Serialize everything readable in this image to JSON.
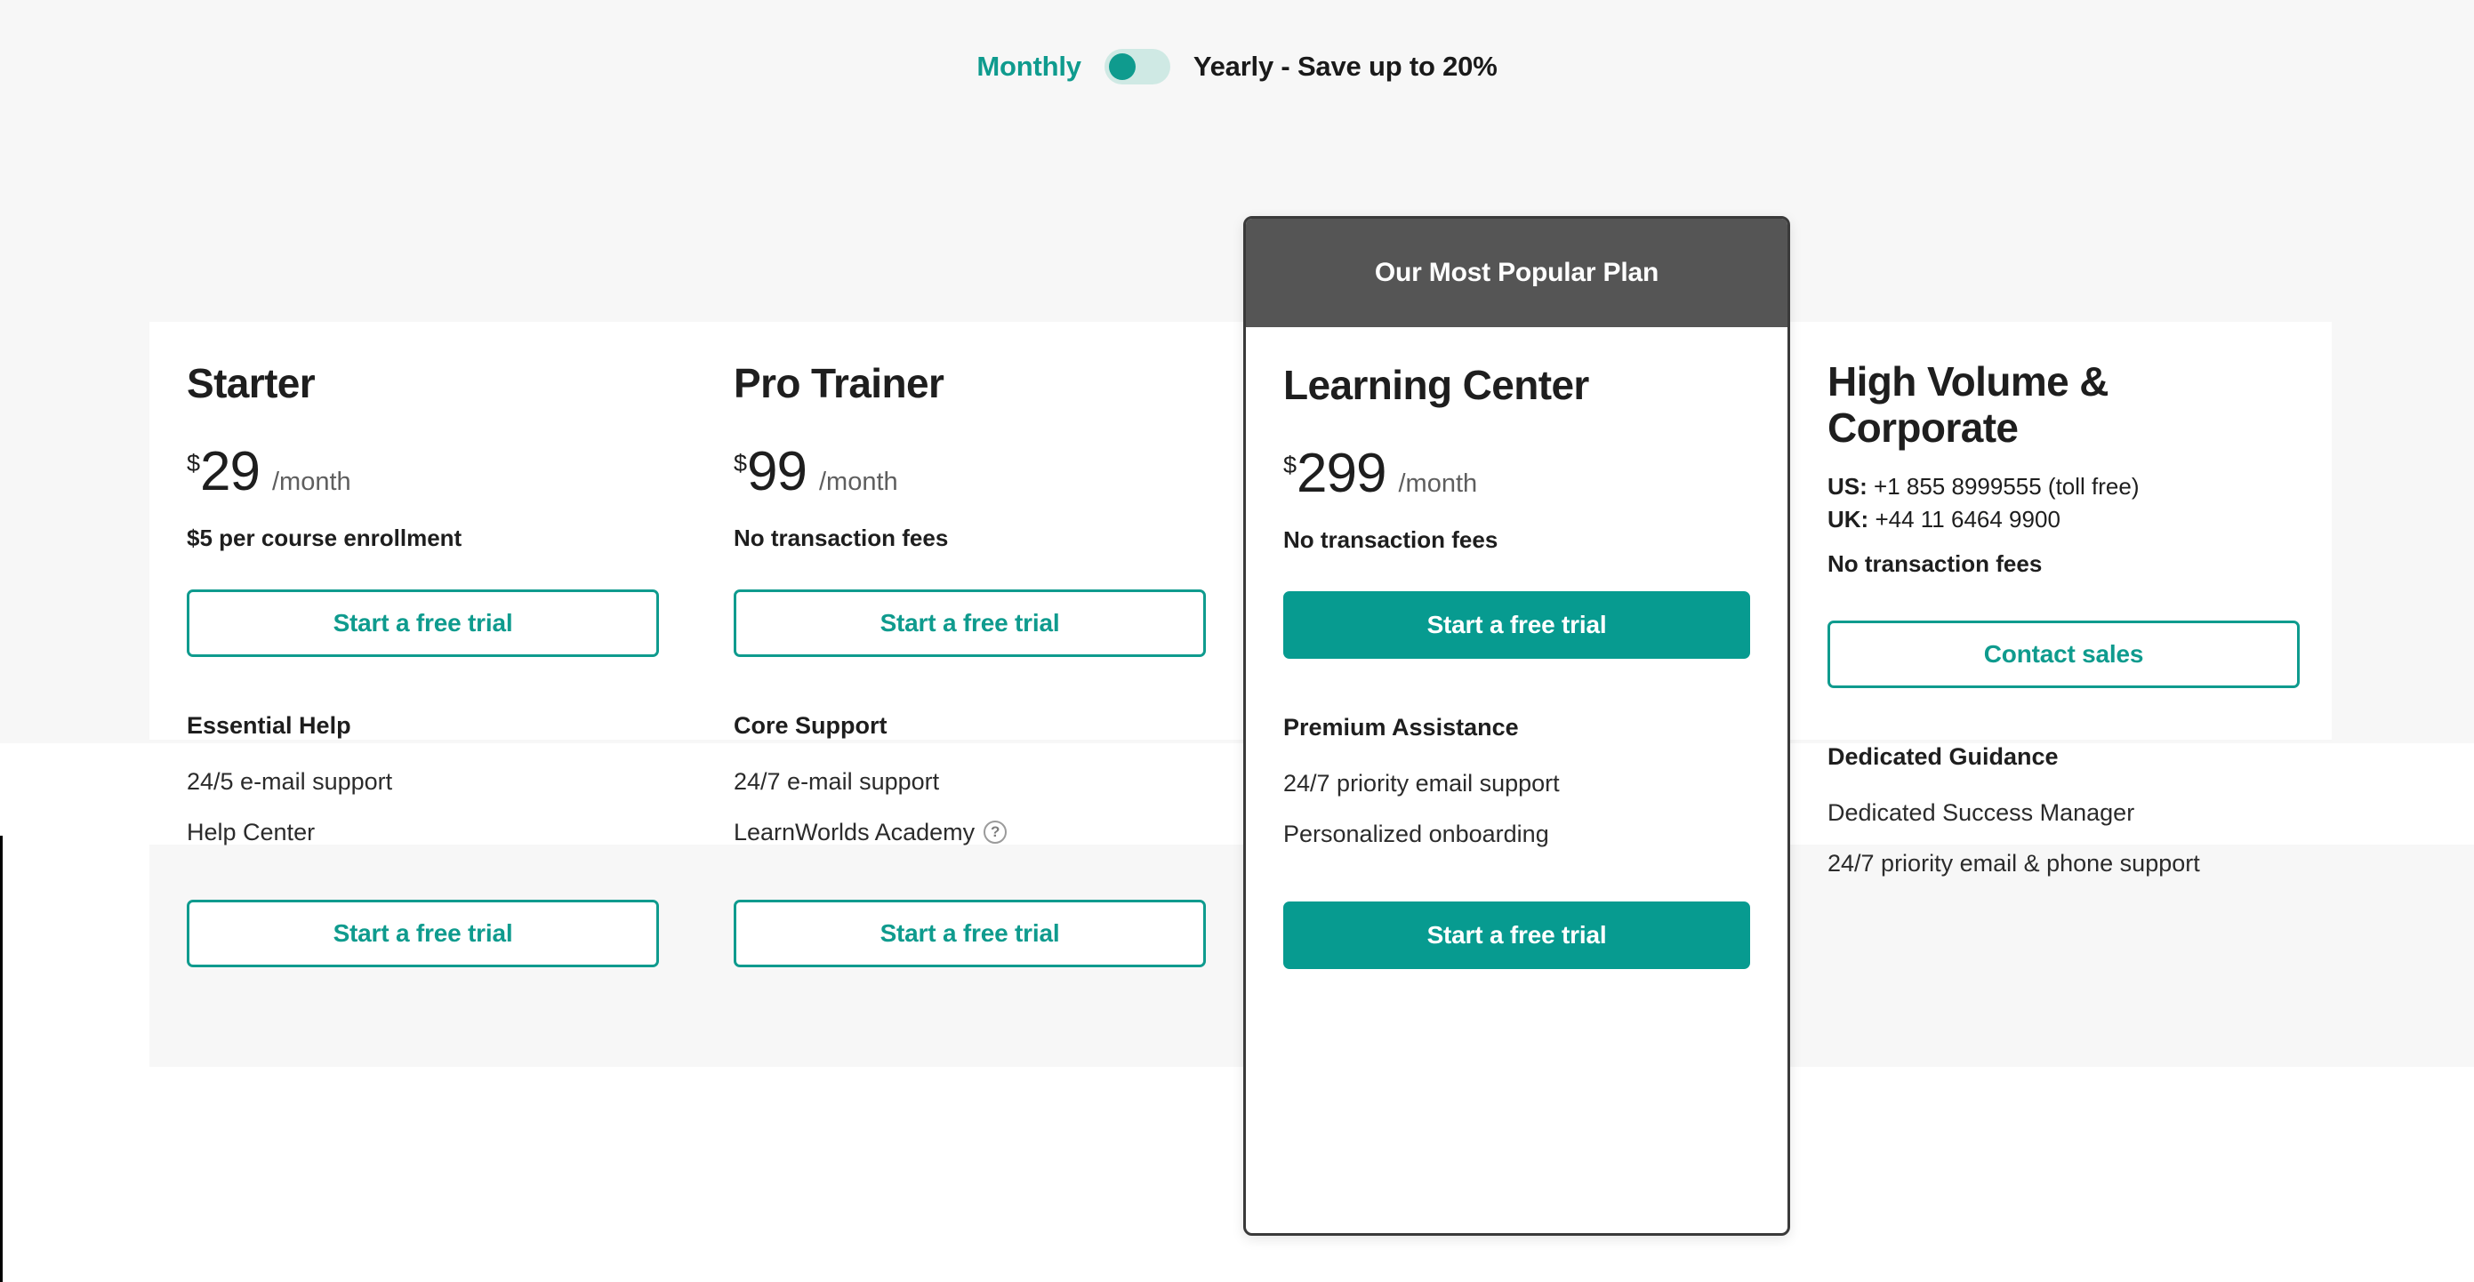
{
  "billing_toggle": {
    "monthly_label": "Monthly",
    "yearly_label": "Yearly - Save up to 20%",
    "active": "Monthly",
    "accent_color": "#0f9b8e",
    "track_color": "#cfe9e4"
  },
  "popular_badge": {
    "label": "Our Most Popular Plan",
    "background_color": "#555555"
  },
  "plans": [
    {
      "name": "Starter",
      "currency": "$",
      "amount": "29",
      "period": "/month",
      "note": "$5 per course enrollment",
      "cta_top": "Start a free trial",
      "cta_bottom": "Start a free trial",
      "feature_title": "Essential Help",
      "features": [
        {
          "label": "24/5 e-mail support",
          "help_icon": false
        },
        {
          "label": "Help Center",
          "help_icon": false
        }
      ]
    },
    {
      "name": "Pro Trainer",
      "currency": "$",
      "amount": "99",
      "period": "/month",
      "note": "No transaction fees",
      "cta_top": "Start a free trial",
      "cta_bottom": "Start a free trial",
      "feature_title": "Core Support",
      "features": [
        {
          "label": "24/7 e-mail support",
          "help_icon": false
        },
        {
          "label": "LearnWorlds Academy",
          "help_icon": true,
          "help_glyph": "?"
        }
      ]
    },
    {
      "name": "Learning Center",
      "currency": "$",
      "amount": "299",
      "period": "/month",
      "note": "No transaction fees",
      "cta_top": "Start a free trial",
      "cta_bottom": "Start a free trial",
      "feature_title": "Premium Assistance",
      "features": [
        {
          "label": "24/7 priority email support",
          "help_icon": false
        },
        {
          "label": "Personalized onboarding",
          "help_icon": false
        }
      ]
    },
    {
      "name": "High Volume & Corporate",
      "contacts": [
        {
          "region": "US:",
          "number": "+1 855 8999555 (toll free)"
        },
        {
          "region": "UK:",
          "number": "+44 11 6464 9900"
        }
      ],
      "note": "No transaction fees",
      "cta_top": "Contact sales",
      "feature_title": "Dedicated Guidance",
      "features": [
        {
          "label": "Dedicated Success Manager",
          "help_icon": false
        },
        {
          "label": "24/7 priority email & phone support",
          "help_icon": false
        }
      ]
    }
  ],
  "colors": {
    "accent": "#0f9b8e",
    "filled_button": "#079b90",
    "text": "#1e1e1e",
    "muted_text": "#5e5e5e",
    "panel_background": "#f7f7f7"
  }
}
